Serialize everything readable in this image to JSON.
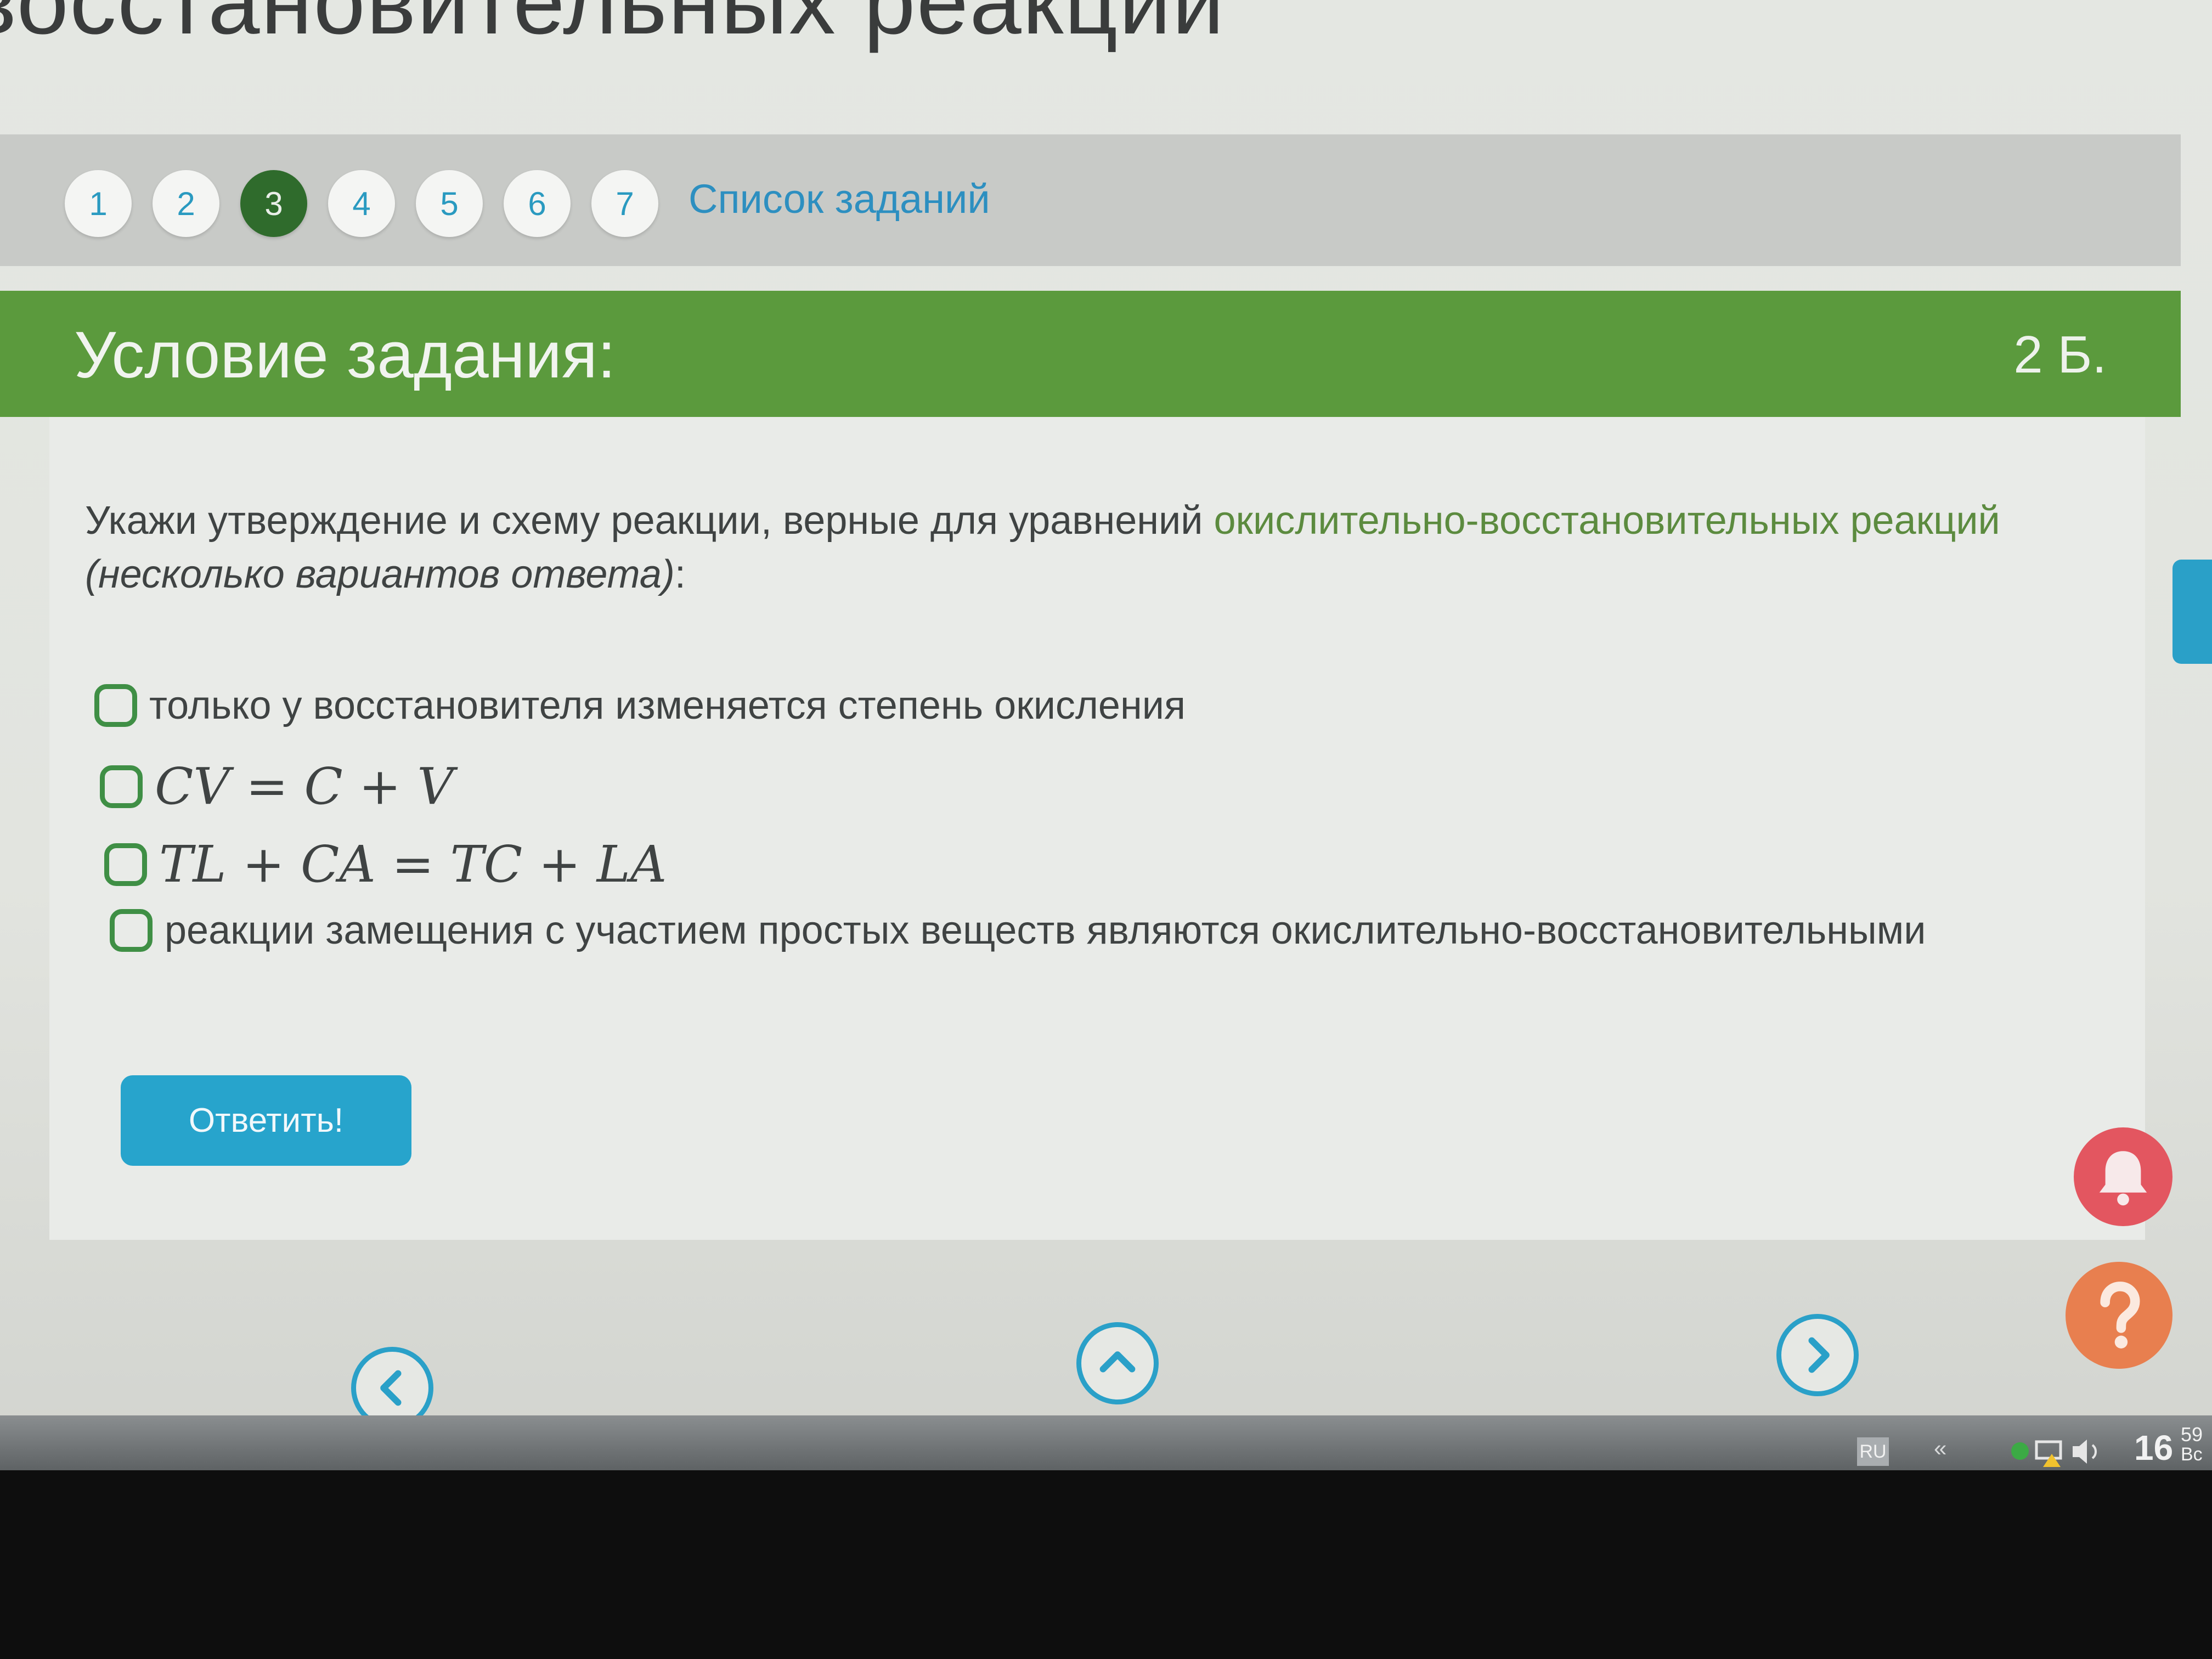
{
  "top_title": "восстановительных реакций",
  "nav": {
    "numbers": [
      "1",
      "2",
      "3",
      "4",
      "5",
      "6",
      "7"
    ],
    "active_index": 2,
    "task_list_label": "Список заданий"
  },
  "task": {
    "header_title": "Условие задания:",
    "points": "2 Б.",
    "question_prefix": "Укажи утверждение и схему реакции, верные для уравнений",
    "question_highlight": "окислительно-восстановительных реакций",
    "question_note": "(несколько вариантов ответа)",
    "question_colon": ":",
    "options": [
      "только у восстановителя изменяется степень окисления",
      "CV = C + V",
      "TL + CA = TC + LA",
      "реакции замещения с участием простых веществ являются окислительно-восстановительными"
    ],
    "answer_button": "Ответить!"
  },
  "bottom_nav": {
    "prev_icon": "chevron-left-icon",
    "up_icon": "chevron-up-icon",
    "next_icon": "chevron-right-icon"
  },
  "floating": {
    "bell_icon": "bell-icon",
    "help_icon": "question-icon"
  },
  "taskbar": {
    "language": "RU",
    "chevron": "«",
    "time_hour": "16",
    "time_minute": "59",
    "day": "Вс"
  },
  "colors": {
    "accent_green": "#5b9a3d",
    "active_page": "#2f6b2c",
    "link_blue": "#2d8fc0",
    "button_blue": "#27a4cc",
    "checkbox_green": "#3f8f45",
    "bell_red": "#e35660",
    "help_orange": "#e87f4f"
  }
}
